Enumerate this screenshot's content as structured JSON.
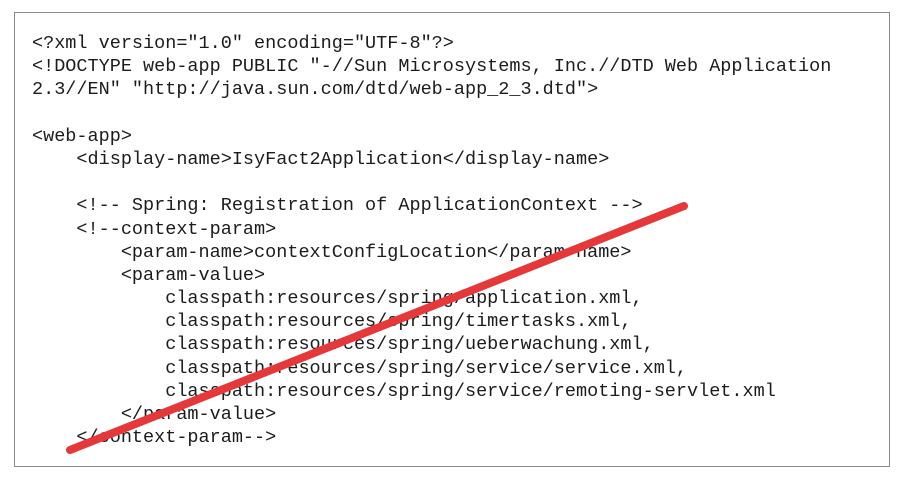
{
  "document": {
    "lines": [
      "<?xml version=\"1.0\" encoding=\"UTF-8\"?>",
      "<!DOCTYPE web-app PUBLIC \"-//Sun Microsystems, Inc.//DTD Web Application",
      "2.3//EN\" \"http://java.sun.com/dtd/web-app_2_3.dtd\">",
      "",
      "<web-app>",
      "    <display-name>IsyFact2Application</display-name>",
      "",
      "    <!-- Spring: Registration of ApplicationContext -->",
      "    <!--context-param>",
      "        <param-name>contextConfigLocation</param-name>",
      "        <param-value>",
      "            classpath:resources/spring/application.xml,",
      "            classpath:resources/spring/timertasks.xml,",
      "            classpath:resources/spring/ueberwachung.xml,",
      "            classpath:resources/spring/service/service.xml,",
      "            classpath:resources/spring/service/remoting-servlet.xml",
      "        </param-value>",
      "    </context-param-->"
    ],
    "strike_color": "#e5383b"
  }
}
